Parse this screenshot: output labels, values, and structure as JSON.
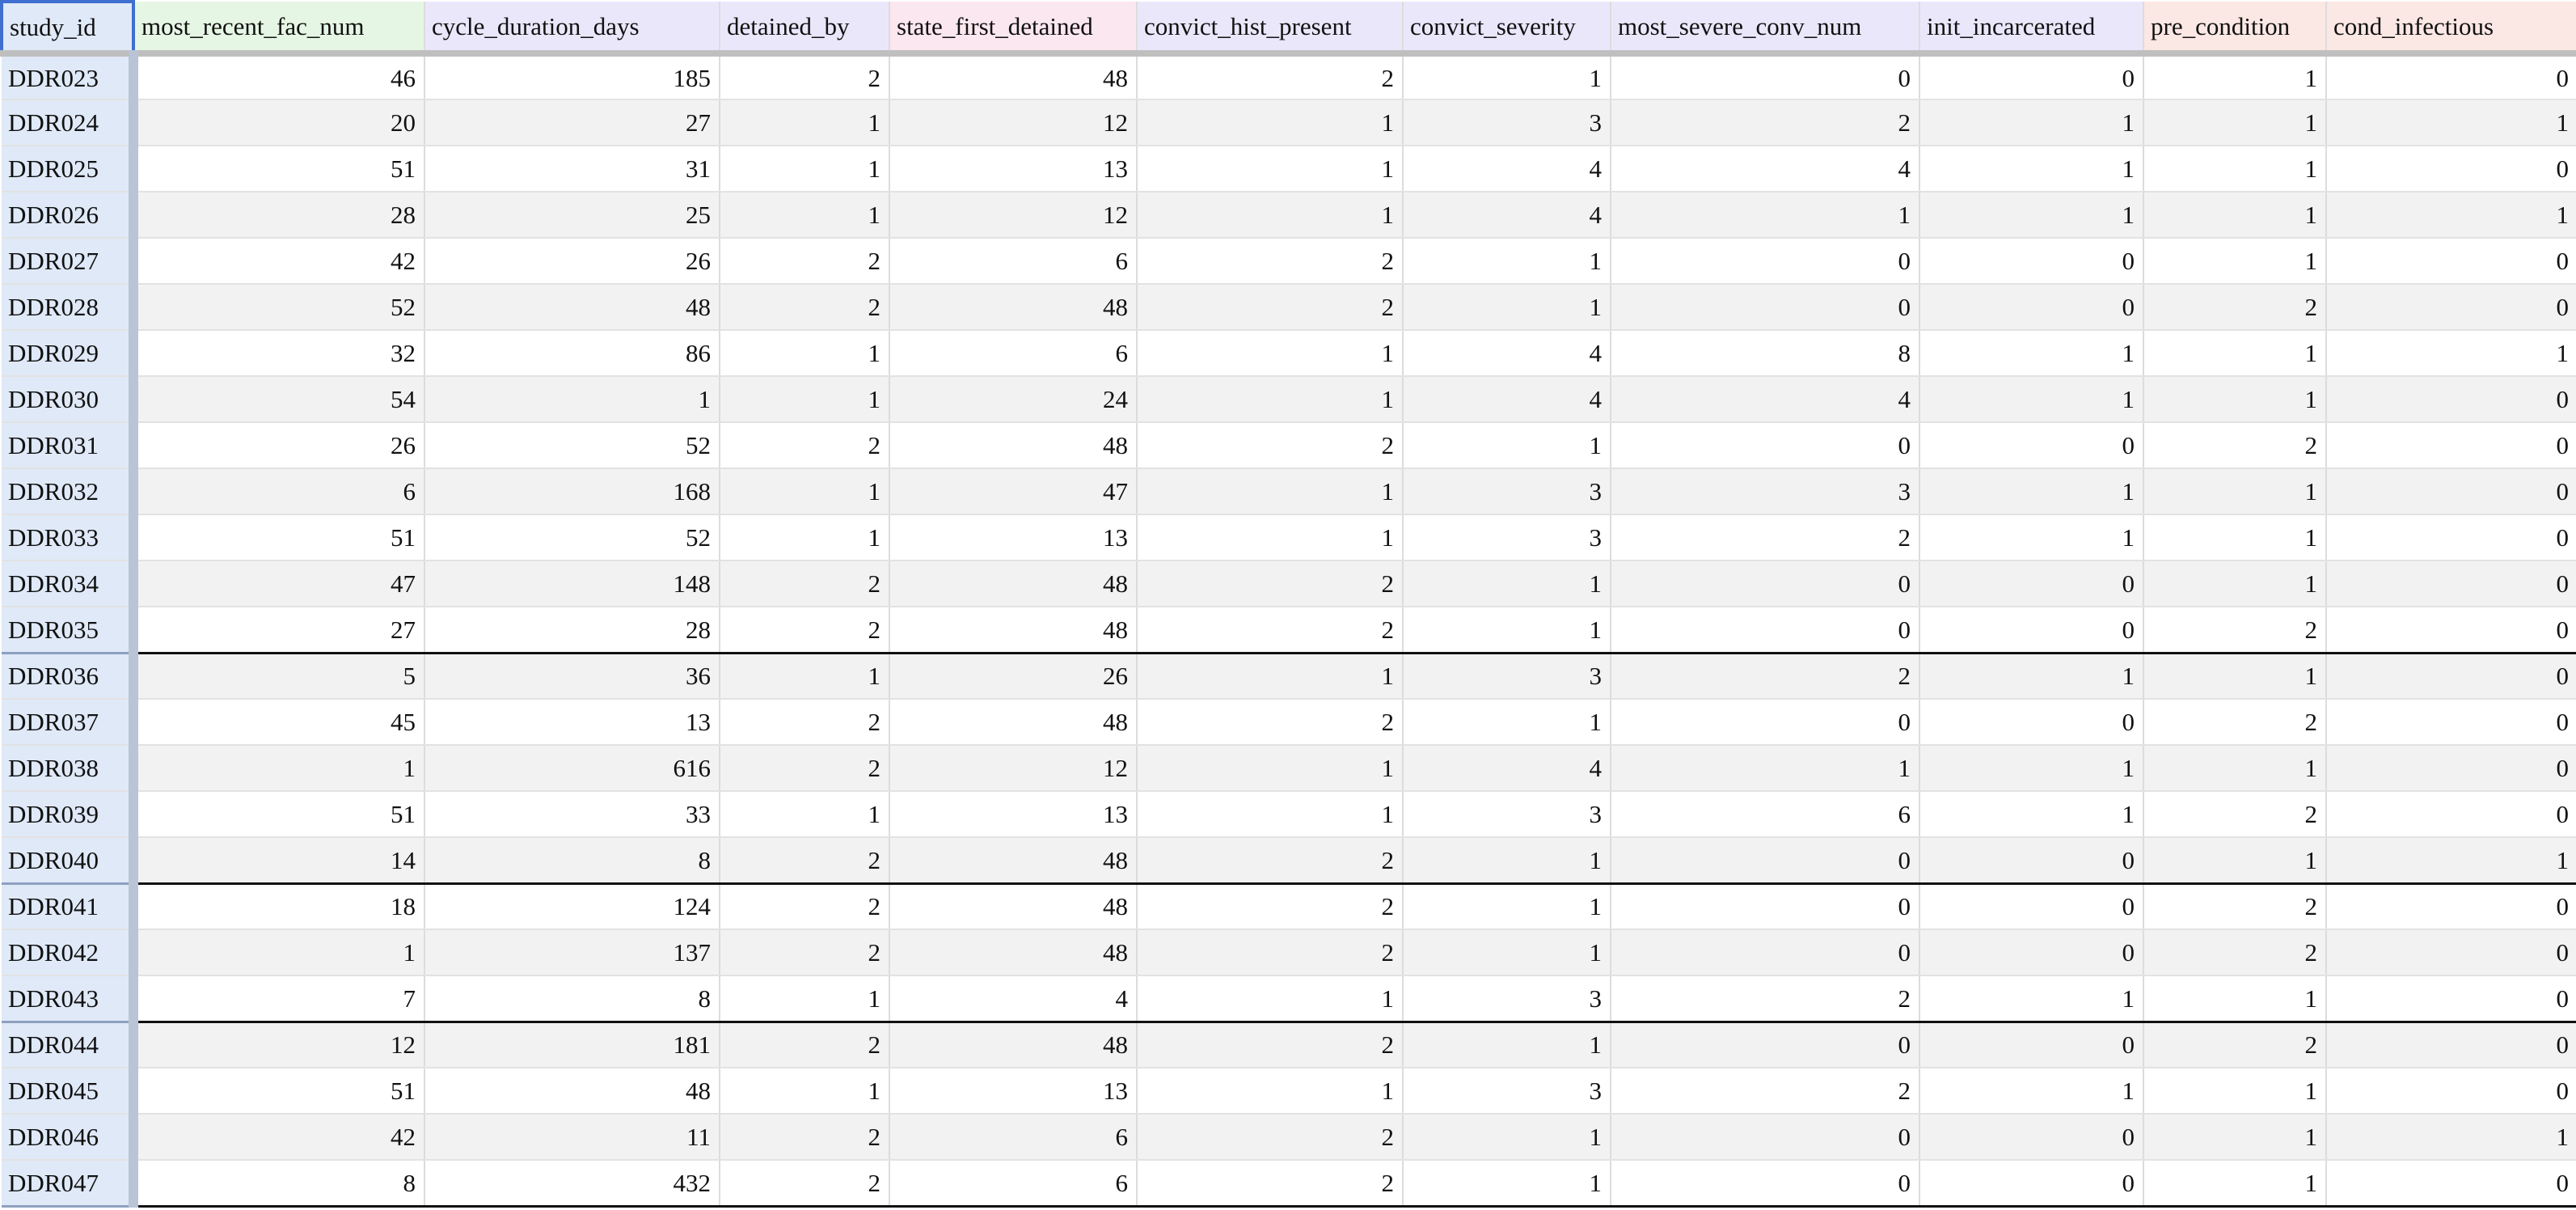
{
  "columns": [
    {
      "key": "study_id",
      "label": "study_id",
      "bg": "#dfe9f7"
    },
    {
      "key": "most_recent_fac_num",
      "label": "most_recent_fac_num",
      "bg": "#e6f6e4"
    },
    {
      "key": "cycle_duration_days",
      "label": "cycle_duration_days",
      "bg": "#ebe7fb"
    },
    {
      "key": "detained_by",
      "label": "detained_by",
      "bg": "#ebe7fb"
    },
    {
      "key": "state_first_detained",
      "label": "state_first_detained",
      "bg": "#fbe7ef"
    },
    {
      "key": "convict_hist_present",
      "label": "convict_hist_present",
      "bg": "#ebe7fb"
    },
    {
      "key": "convict_severity",
      "label": "convict_severity",
      "bg": "#ebe7fb"
    },
    {
      "key": "most_severe_conv_num",
      "label": "most_severe_conv_num",
      "bg": "#ebe7fb"
    },
    {
      "key": "init_incarcerated",
      "label": "init_incarcerated",
      "bg": "#ebe7fb"
    },
    {
      "key": "pre_condition",
      "label": "pre_condition",
      "bg": "#fbe7e4"
    },
    {
      "key": "cond_infectious",
      "label": "cond_infectious",
      "bg": "#fbe7e4"
    }
  ],
  "rows": [
    {
      "study_id": "DDR023",
      "values": [
        "46",
        "185",
        "2",
        "48",
        "2",
        "1",
        "0",
        "0",
        "1",
        "0"
      ],
      "group_end": false
    },
    {
      "study_id": "DDR024",
      "values": [
        "20",
        "27",
        "1",
        "12",
        "1",
        "3",
        "2",
        "1",
        "1",
        "1"
      ],
      "group_end": false
    },
    {
      "study_id": "DDR025",
      "values": [
        "51",
        "31",
        "1",
        "13",
        "1",
        "4",
        "4",
        "1",
        "1",
        "0"
      ],
      "group_end": false
    },
    {
      "study_id": "DDR026",
      "values": [
        "28",
        "25",
        "1",
        "12",
        "1",
        "4",
        "1",
        "1",
        "1",
        "1"
      ],
      "group_end": false
    },
    {
      "study_id": "DDR027",
      "values": [
        "42",
        "26",
        "2",
        "6",
        "2",
        "1",
        "0",
        "0",
        "1",
        "0"
      ],
      "group_end": false
    },
    {
      "study_id": "DDR028",
      "values": [
        "52",
        "48",
        "2",
        "48",
        "2",
        "1",
        "0",
        "0",
        "2",
        "0"
      ],
      "group_end": false
    },
    {
      "study_id": "DDR029",
      "values": [
        "32",
        "86",
        "1",
        "6",
        "1",
        "4",
        "8",
        "1",
        "1",
        "1"
      ],
      "group_end": false
    },
    {
      "study_id": "DDR030",
      "values": [
        "54",
        "1",
        "1",
        "24",
        "1",
        "4",
        "4",
        "1",
        "1",
        "0"
      ],
      "group_end": false
    },
    {
      "study_id": "DDR031",
      "values": [
        "26",
        "52",
        "2",
        "48",
        "2",
        "1",
        "0",
        "0",
        "2",
        "0"
      ],
      "group_end": false
    },
    {
      "study_id": "DDR032",
      "values": [
        "6",
        "168",
        "1",
        "47",
        "1",
        "3",
        "3",
        "1",
        "1",
        "0"
      ],
      "group_end": false
    },
    {
      "study_id": "DDR033",
      "values": [
        "51",
        "52",
        "1",
        "13",
        "1",
        "3",
        "2",
        "1",
        "1",
        "0"
      ],
      "group_end": false
    },
    {
      "study_id": "DDR034",
      "values": [
        "47",
        "148",
        "2",
        "48",
        "2",
        "1",
        "0",
        "0",
        "1",
        "0"
      ],
      "group_end": false
    },
    {
      "study_id": "DDR035",
      "values": [
        "27",
        "28",
        "2",
        "48",
        "2",
        "1",
        "0",
        "0",
        "2",
        "0"
      ],
      "group_end": true
    },
    {
      "study_id": "DDR036",
      "values": [
        "5",
        "36",
        "1",
        "26",
        "1",
        "3",
        "2",
        "1",
        "1",
        "0"
      ],
      "group_end": false
    },
    {
      "study_id": "DDR037",
      "values": [
        "45",
        "13",
        "2",
        "48",
        "2",
        "1",
        "0",
        "0",
        "2",
        "0"
      ],
      "group_end": false
    },
    {
      "study_id": "DDR038",
      "values": [
        "1",
        "616",
        "2",
        "12",
        "1",
        "4",
        "1",
        "1",
        "1",
        "0"
      ],
      "group_end": false
    },
    {
      "study_id": "DDR039",
      "values": [
        "51",
        "33",
        "1",
        "13",
        "1",
        "3",
        "6",
        "1",
        "2",
        "0"
      ],
      "group_end": false
    },
    {
      "study_id": "DDR040",
      "values": [
        "14",
        "8",
        "2",
        "48",
        "2",
        "1",
        "0",
        "0",
        "1",
        "1"
      ],
      "group_end": true
    },
    {
      "study_id": "DDR041",
      "values": [
        "18",
        "124",
        "2",
        "48",
        "2",
        "1",
        "0",
        "0",
        "2",
        "0"
      ],
      "group_end": false
    },
    {
      "study_id": "DDR042",
      "values": [
        "1",
        "137",
        "2",
        "48",
        "2",
        "1",
        "0",
        "0",
        "2",
        "0"
      ],
      "group_end": false
    },
    {
      "study_id": "DDR043",
      "values": [
        "7",
        "8",
        "1",
        "4",
        "1",
        "3",
        "2",
        "1",
        "1",
        "0"
      ],
      "group_end": true
    },
    {
      "study_id": "DDR044",
      "values": [
        "12",
        "181",
        "2",
        "48",
        "2",
        "1",
        "0",
        "0",
        "2",
        "0"
      ],
      "group_end": false
    },
    {
      "study_id": "DDR045",
      "values": [
        "51",
        "48",
        "1",
        "13",
        "1",
        "3",
        "2",
        "1",
        "1",
        "0"
      ],
      "group_end": false
    },
    {
      "study_id": "DDR046",
      "values": [
        "42",
        "11",
        "2",
        "6",
        "2",
        "1",
        "0",
        "0",
        "1",
        "1"
      ],
      "group_end": false
    },
    {
      "study_id": "DDR047",
      "values": [
        "8",
        "432",
        "2",
        "6",
        "2",
        "1",
        "0",
        "0",
        "1",
        "0"
      ],
      "group_end": true
    }
  ]
}
